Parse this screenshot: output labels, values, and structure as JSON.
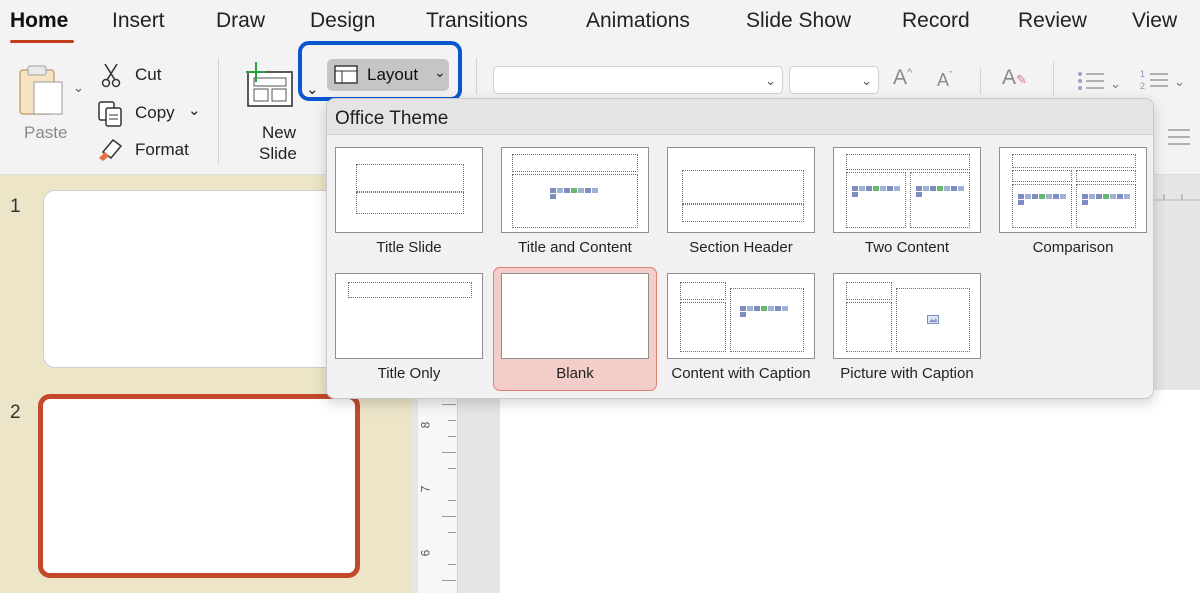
{
  "tabs": [
    "Home",
    "Insert",
    "Draw",
    "Design",
    "Transitions",
    "Animations",
    "Slide Show",
    "Record",
    "Review",
    "View"
  ],
  "ribbon": {
    "paste": "Paste",
    "cut": "Cut",
    "copy": "Copy",
    "format": "Format",
    "new_slide_line1": "New",
    "new_slide_line2": "Slide",
    "layout": "Layout"
  },
  "gallery": {
    "title": "Office Theme",
    "layouts": [
      "Title Slide",
      "Title and Content",
      "Section Header",
      "Two Content",
      "Comparison",
      "Title Only",
      "Blank",
      "Content with Caption",
      "Picture with Caption"
    ],
    "selected": "Blank"
  },
  "slides": [
    "1",
    "2"
  ],
  "ruler": [
    "8",
    "7",
    "6"
  ],
  "colors": {
    "accent": "#c43e1c",
    "highlight": "#0b57d0",
    "selected_item": "#f3cdc7",
    "thumb_panel": "#ece5c8"
  }
}
